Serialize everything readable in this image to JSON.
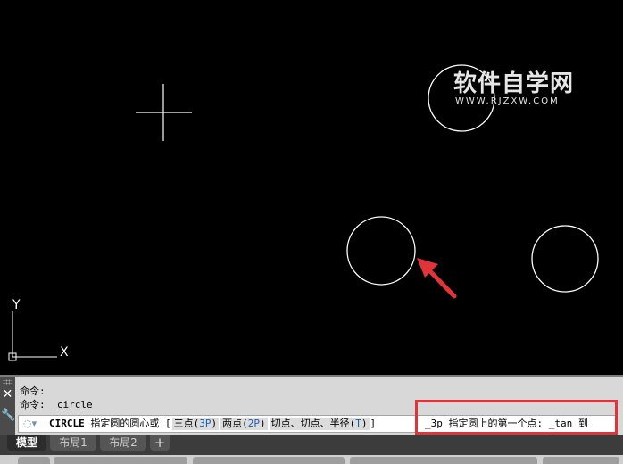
{
  "watermark": {
    "title": "软件自学网",
    "url": "WWW.RJZXW.COM"
  },
  "axes": {
    "x_label": "X",
    "y_label": "Y"
  },
  "command_history": [
    "命令:",
    "命令: _circle"
  ],
  "command_line": {
    "command": "CIRCLE",
    "prompt": "指定圆的圆心或",
    "bracket_open": "[",
    "bracket_close": "]",
    "options": [
      {
        "label": "三点(",
        "key": "3P",
        "end": ")"
      },
      {
        "label": "两点(",
        "key": "2P",
        "end": ")"
      },
      {
        "label": "切点、切点、半径(",
        "key": "T",
        "end": ")"
      }
    ],
    "continuation": "_3p 指定圆上的第一个点: _tan 到"
  },
  "layout_tabs": [
    "模型",
    "布局1",
    "布局2"
  ],
  "add_tab": "+",
  "colors": {
    "canvas": "#000000",
    "highlight": "#e0343a",
    "arrow": "#e0343a",
    "option_key": "#1a5fb4"
  },
  "icons": {
    "close": "close-icon",
    "settings": "wrench-icon",
    "command": "command-icon"
  }
}
